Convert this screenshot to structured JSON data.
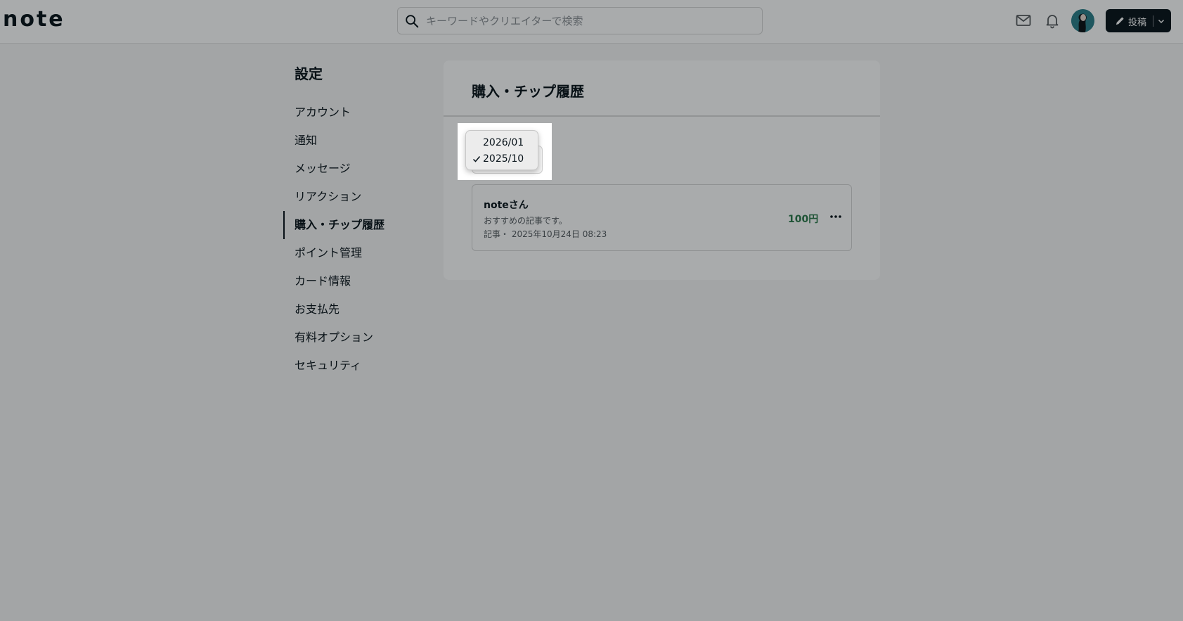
{
  "header": {
    "logo": "note",
    "search": {
      "placeholder": "キーワードやクリエイターで検索",
      "value": ""
    },
    "post_button": {
      "label": "投稿"
    },
    "icons": [
      "search-icon",
      "mail-icon",
      "bell-icon",
      "avatar",
      "pencil-icon",
      "chevron-down-icon"
    ]
  },
  "sidebar": {
    "title": "設定",
    "items": [
      {
        "label": "アカウント"
      },
      {
        "label": "通知"
      },
      {
        "label": "メッセージ"
      },
      {
        "label": "リアクション"
      },
      {
        "label": "購入・チップ履歴",
        "active": true
      },
      {
        "label": "ポイント管理"
      },
      {
        "label": "カード情報"
      },
      {
        "label": "お支払先"
      },
      {
        "label": "有料オプション"
      },
      {
        "label": "セキュリティ"
      }
    ]
  },
  "main": {
    "title": "購入・チップ履歴",
    "month_select": {
      "options": [
        {
          "label": "2026/01",
          "selected": false
        },
        {
          "label": "2025/10",
          "selected": true
        }
      ]
    },
    "history": [
      {
        "creator": "noteさん",
        "description": "おすすめの記事です。",
        "meta": "記事・ 2025年10月24日 08:23",
        "price": "100円"
      }
    ]
  },
  "colors": {
    "accent": "#08131a",
    "price": "#2b7a4b",
    "avatar": "#2c7e89"
  }
}
